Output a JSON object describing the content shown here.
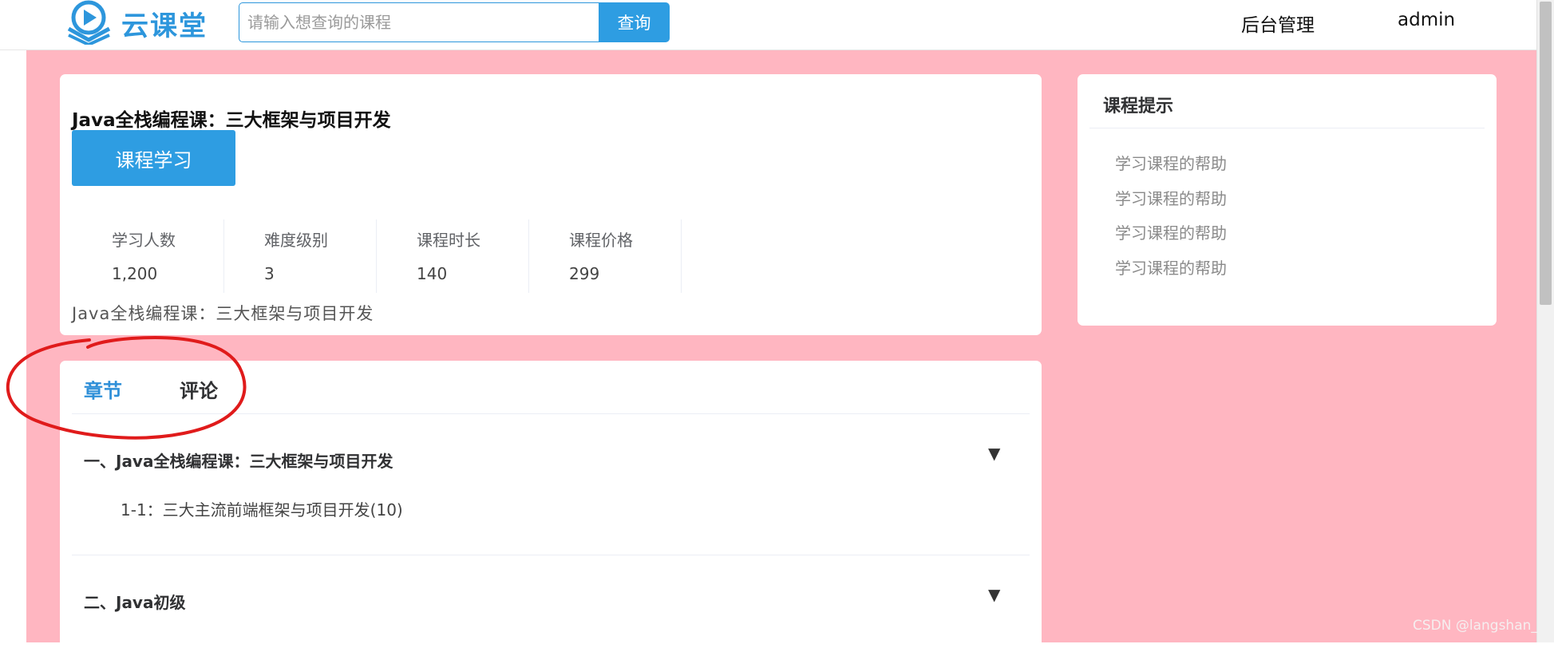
{
  "header": {
    "brand": "云课堂",
    "search_placeholder": "请输入想查询的课程",
    "search_button": "查询",
    "nav_admin": "后台管理",
    "nav_user": "admin"
  },
  "course": {
    "title": "Java全栈编程课：三大框架与项目开发",
    "study_button": "课程学习",
    "stats": [
      {
        "label": "学习人数",
        "value": "1,200"
      },
      {
        "label": "难度级别",
        "value": "3"
      },
      {
        "label": "课程时长",
        "value": "140"
      },
      {
        "label": "课程价格",
        "value": "299"
      }
    ],
    "description": "Java全栈编程课：三大框架与项目开发"
  },
  "tips": {
    "title": "课程提示",
    "items": [
      "学习课程的帮助",
      "学习课程的帮助",
      "学习课程的帮助",
      "学习课程的帮助"
    ]
  },
  "tabs": {
    "chapters": "章节",
    "comments": "评论"
  },
  "chapters": [
    {
      "title": "一、Java全栈编程课：三大框架与项目开发",
      "lessons": [
        "1-1：三大主流前端框架与项目开发(10)"
      ]
    },
    {
      "title": "二、Java初级",
      "lessons": []
    }
  ],
  "icons": {
    "expand": "▼"
  },
  "colors": {
    "primary": "#2e9de2",
    "background": "#ffb6c1",
    "annotation": "#e01b1b"
  },
  "watermark": "CSDN @langshan_"
}
